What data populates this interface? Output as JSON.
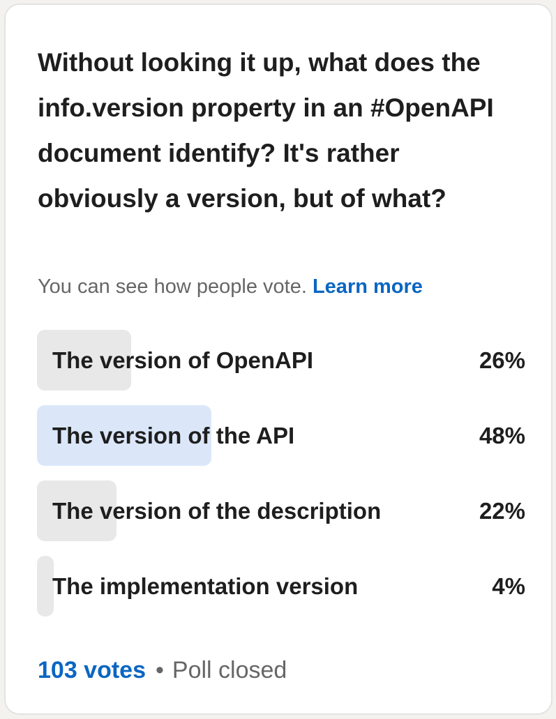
{
  "poll": {
    "question": "Without looking it up, what does the info.version property in an #OpenAPI document identify? It's rather obviously a version, but of what?",
    "note": "You can see how people vote.",
    "learn_more": "Learn more",
    "options": [
      {
        "label": "The version of OpenAPI",
        "percent_label": "26%",
        "fraction": 0.26,
        "selected": false
      },
      {
        "label": "The version of the API",
        "percent_label": "48%",
        "fraction": 0.48,
        "selected": true
      },
      {
        "label": "The version of the description",
        "percent_label": "22%",
        "fraction": 0.22,
        "selected": false
      },
      {
        "label": "The implementation version",
        "percent_label": "4%",
        "fraction": 0.04,
        "selected": false
      }
    ],
    "votes": "103 votes",
    "separator": "•",
    "status": "Poll closed"
  },
  "colors": {
    "accent": "#0a66c2",
    "bar_default": "#e8e8e8",
    "bar_selected": "#dbe7f9"
  }
}
